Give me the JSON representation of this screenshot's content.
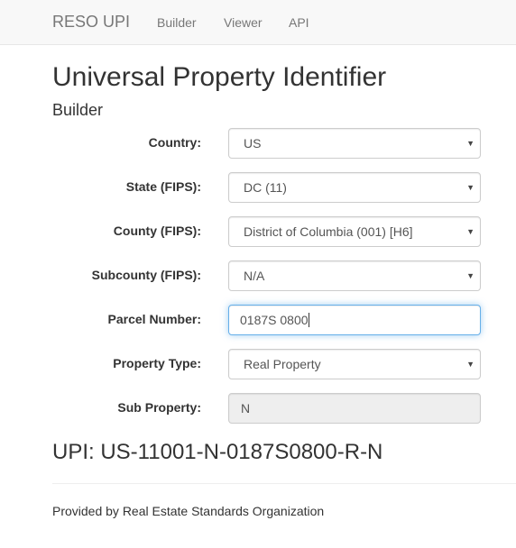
{
  "navbar": {
    "brand": "RESO UPI",
    "links": [
      {
        "label": "Builder"
      },
      {
        "label": "Viewer"
      },
      {
        "label": "API"
      }
    ]
  },
  "header": {
    "title": "Universal Property Identifier",
    "subtitle": "Builder"
  },
  "form": {
    "country": {
      "label": "Country:",
      "value": "US",
      "icon": "caret-down-icon"
    },
    "state": {
      "label": "State (FIPS):",
      "value": "DC (11)",
      "icon": "caret-down-icon"
    },
    "county": {
      "label": "County (FIPS):",
      "value": "District of Columbia (001) [H6]",
      "icon": "caret-down-icon"
    },
    "subcounty": {
      "label": "Subcounty (FIPS):",
      "value": "N/A",
      "icon": "caret-down-icon"
    },
    "parcel": {
      "label": "Parcel Number:",
      "value": "0187S 0800"
    },
    "property_type": {
      "label": "Property Type:",
      "value": "Real Property",
      "icon": "caret-down-icon"
    },
    "sub_property": {
      "label": "Sub Property:",
      "value": "N"
    }
  },
  "result": {
    "upi": "UPI: US-11001-N-0187S0800-R-N"
  },
  "footer": {
    "text": "Provided by Real Estate Standards Organization"
  },
  "colors": {
    "navbar_bg": "#f8f8f8",
    "focus_border": "#66afe9",
    "disabled_bg": "#eeeeee"
  }
}
